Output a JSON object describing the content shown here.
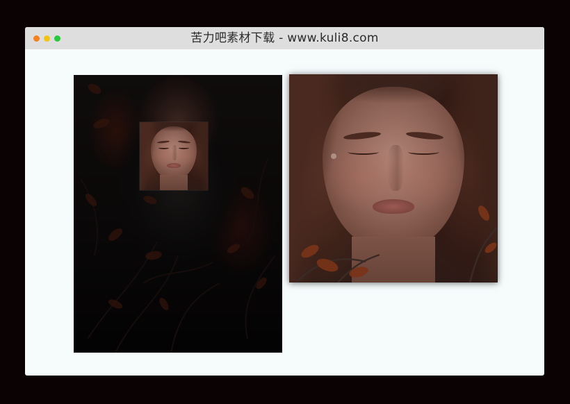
{
  "window": {
    "title": "苦力吧素材下载 - www.kuli8.com",
    "controls": {
      "close_color": "#f5821f",
      "minimize_color": "#f1c40f",
      "maximize_color": "#27c93f"
    }
  },
  "source_image": {
    "subject": "woman with closed eyes among autumn branches",
    "dimmed": true
  },
  "zoom_preview": {
    "subject": "magnified face region of source image"
  },
  "colors": {
    "page_background": "#0b0203",
    "window_background": "#f6fbfc",
    "titlebar_background": "#dedede"
  }
}
